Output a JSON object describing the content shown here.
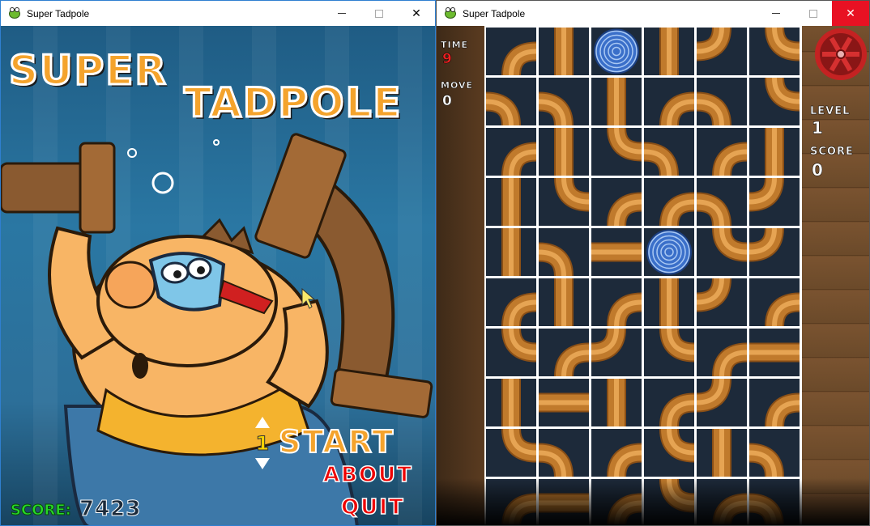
{
  "windows": [
    {
      "title": "Super Tadpole"
    },
    {
      "title": "Super Tadpole"
    }
  ],
  "menu": {
    "logo_line1": "SUPER",
    "logo_line2": "TADPOLE",
    "level_number": "1",
    "start_label": "START",
    "about_label": "ABOUT",
    "quit_label": "QUIT",
    "score_label": "SCORE:",
    "score_value": "7423"
  },
  "puzzle": {
    "time_label": "TIME",
    "time_value": "9",
    "move_label": "MOVE",
    "move_value": "0",
    "level_label": "LEVEL",
    "level_value": "1",
    "score_label": "SCORE",
    "score_value": "0",
    "tiles": [
      [
        "curve-se",
        "straight-v",
        "spiral",
        "straight-v",
        "curve-nw",
        "curve-ne"
      ],
      [
        "curve-sw",
        "curve-ws",
        "straight-v",
        "curve-se",
        "curve-sw",
        "curve-ne"
      ],
      [
        "curve-se",
        "straight-v",
        "curve-ne",
        "curve-sw",
        "curve-se",
        "straight-v"
      ],
      [
        "straight-v",
        "curve-ne",
        "curve-se",
        "curve-se",
        "curve-sw",
        "curve-nw"
      ],
      [
        "straight-v",
        "curve-sw",
        "straight-h",
        "spiral",
        "curve-ne",
        "curve-nw"
      ],
      [
        "curve-se",
        "straight-v",
        "curve-se",
        "straight-v",
        "curve-nw",
        "curve-se"
      ],
      [
        "curve-ne",
        "curve-se",
        "curve-nw",
        "curve-ne",
        "curve-se",
        "straight-h"
      ],
      [
        "straight-v",
        "straight-h",
        "straight-v",
        "curve-se",
        "curve-nw",
        "curve-se"
      ],
      [
        "curve-ne",
        "curve-sw",
        "curve-se",
        "curve-ne",
        "straight-v",
        "curve-sw"
      ],
      [
        "curve-se",
        "straight-h",
        "curve-se",
        "curve-ne",
        "curve-se",
        "curve-sw"
      ]
    ]
  },
  "colors": {
    "pipe": "#c07a2c",
    "pipe_dark": "#8a4f16",
    "pipe_light": "#e6a453",
    "cell_bg": "#1d2a3a",
    "spiral": "#3a6fc9"
  }
}
